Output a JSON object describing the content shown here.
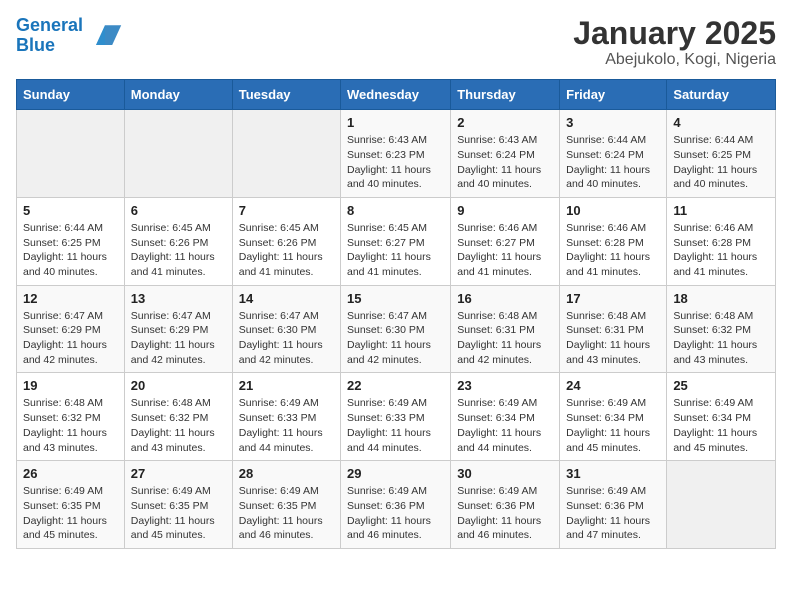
{
  "header": {
    "logo_line1": "General",
    "logo_line2": "Blue",
    "title": "January 2025",
    "subtitle": "Abejukolo, Kogi, Nigeria"
  },
  "weekdays": [
    "Sunday",
    "Monday",
    "Tuesday",
    "Wednesday",
    "Thursday",
    "Friday",
    "Saturday"
  ],
  "weeks": [
    [
      {
        "day": "",
        "sunrise": "",
        "sunset": "",
        "daylight": ""
      },
      {
        "day": "",
        "sunrise": "",
        "sunset": "",
        "daylight": ""
      },
      {
        "day": "",
        "sunrise": "",
        "sunset": "",
        "daylight": ""
      },
      {
        "day": "1",
        "sunrise": "Sunrise: 6:43 AM",
        "sunset": "Sunset: 6:23 PM",
        "daylight": "Daylight: 11 hours and 40 minutes."
      },
      {
        "day": "2",
        "sunrise": "Sunrise: 6:43 AM",
        "sunset": "Sunset: 6:24 PM",
        "daylight": "Daylight: 11 hours and 40 minutes."
      },
      {
        "day": "3",
        "sunrise": "Sunrise: 6:44 AM",
        "sunset": "Sunset: 6:24 PM",
        "daylight": "Daylight: 11 hours and 40 minutes."
      },
      {
        "day": "4",
        "sunrise": "Sunrise: 6:44 AM",
        "sunset": "Sunset: 6:25 PM",
        "daylight": "Daylight: 11 hours and 40 minutes."
      }
    ],
    [
      {
        "day": "5",
        "sunrise": "Sunrise: 6:44 AM",
        "sunset": "Sunset: 6:25 PM",
        "daylight": "Daylight: 11 hours and 40 minutes."
      },
      {
        "day": "6",
        "sunrise": "Sunrise: 6:45 AM",
        "sunset": "Sunset: 6:26 PM",
        "daylight": "Daylight: 11 hours and 41 minutes."
      },
      {
        "day": "7",
        "sunrise": "Sunrise: 6:45 AM",
        "sunset": "Sunset: 6:26 PM",
        "daylight": "Daylight: 11 hours and 41 minutes."
      },
      {
        "day": "8",
        "sunrise": "Sunrise: 6:45 AM",
        "sunset": "Sunset: 6:27 PM",
        "daylight": "Daylight: 11 hours and 41 minutes."
      },
      {
        "day": "9",
        "sunrise": "Sunrise: 6:46 AM",
        "sunset": "Sunset: 6:27 PM",
        "daylight": "Daylight: 11 hours and 41 minutes."
      },
      {
        "day": "10",
        "sunrise": "Sunrise: 6:46 AM",
        "sunset": "Sunset: 6:28 PM",
        "daylight": "Daylight: 11 hours and 41 minutes."
      },
      {
        "day": "11",
        "sunrise": "Sunrise: 6:46 AM",
        "sunset": "Sunset: 6:28 PM",
        "daylight": "Daylight: 11 hours and 41 minutes."
      }
    ],
    [
      {
        "day": "12",
        "sunrise": "Sunrise: 6:47 AM",
        "sunset": "Sunset: 6:29 PM",
        "daylight": "Daylight: 11 hours and 42 minutes."
      },
      {
        "day": "13",
        "sunrise": "Sunrise: 6:47 AM",
        "sunset": "Sunset: 6:29 PM",
        "daylight": "Daylight: 11 hours and 42 minutes."
      },
      {
        "day": "14",
        "sunrise": "Sunrise: 6:47 AM",
        "sunset": "Sunset: 6:30 PM",
        "daylight": "Daylight: 11 hours and 42 minutes."
      },
      {
        "day": "15",
        "sunrise": "Sunrise: 6:47 AM",
        "sunset": "Sunset: 6:30 PM",
        "daylight": "Daylight: 11 hours and 42 minutes."
      },
      {
        "day": "16",
        "sunrise": "Sunrise: 6:48 AM",
        "sunset": "Sunset: 6:31 PM",
        "daylight": "Daylight: 11 hours and 42 minutes."
      },
      {
        "day": "17",
        "sunrise": "Sunrise: 6:48 AM",
        "sunset": "Sunset: 6:31 PM",
        "daylight": "Daylight: 11 hours and 43 minutes."
      },
      {
        "day": "18",
        "sunrise": "Sunrise: 6:48 AM",
        "sunset": "Sunset: 6:32 PM",
        "daylight": "Daylight: 11 hours and 43 minutes."
      }
    ],
    [
      {
        "day": "19",
        "sunrise": "Sunrise: 6:48 AM",
        "sunset": "Sunset: 6:32 PM",
        "daylight": "Daylight: 11 hours and 43 minutes."
      },
      {
        "day": "20",
        "sunrise": "Sunrise: 6:48 AM",
        "sunset": "Sunset: 6:32 PM",
        "daylight": "Daylight: 11 hours and 43 minutes."
      },
      {
        "day": "21",
        "sunrise": "Sunrise: 6:49 AM",
        "sunset": "Sunset: 6:33 PM",
        "daylight": "Daylight: 11 hours and 44 minutes."
      },
      {
        "day": "22",
        "sunrise": "Sunrise: 6:49 AM",
        "sunset": "Sunset: 6:33 PM",
        "daylight": "Daylight: 11 hours and 44 minutes."
      },
      {
        "day": "23",
        "sunrise": "Sunrise: 6:49 AM",
        "sunset": "Sunset: 6:34 PM",
        "daylight": "Daylight: 11 hours and 44 minutes."
      },
      {
        "day": "24",
        "sunrise": "Sunrise: 6:49 AM",
        "sunset": "Sunset: 6:34 PM",
        "daylight": "Daylight: 11 hours and 45 minutes."
      },
      {
        "day": "25",
        "sunrise": "Sunrise: 6:49 AM",
        "sunset": "Sunset: 6:34 PM",
        "daylight": "Daylight: 11 hours and 45 minutes."
      }
    ],
    [
      {
        "day": "26",
        "sunrise": "Sunrise: 6:49 AM",
        "sunset": "Sunset: 6:35 PM",
        "daylight": "Daylight: 11 hours and 45 minutes."
      },
      {
        "day": "27",
        "sunrise": "Sunrise: 6:49 AM",
        "sunset": "Sunset: 6:35 PM",
        "daylight": "Daylight: 11 hours and 45 minutes."
      },
      {
        "day": "28",
        "sunrise": "Sunrise: 6:49 AM",
        "sunset": "Sunset: 6:35 PM",
        "daylight": "Daylight: 11 hours and 46 minutes."
      },
      {
        "day": "29",
        "sunrise": "Sunrise: 6:49 AM",
        "sunset": "Sunset: 6:36 PM",
        "daylight": "Daylight: 11 hours and 46 minutes."
      },
      {
        "day": "30",
        "sunrise": "Sunrise: 6:49 AM",
        "sunset": "Sunset: 6:36 PM",
        "daylight": "Daylight: 11 hours and 46 minutes."
      },
      {
        "day": "31",
        "sunrise": "Sunrise: 6:49 AM",
        "sunset": "Sunset: 6:36 PM",
        "daylight": "Daylight: 11 hours and 47 minutes."
      },
      {
        "day": "",
        "sunrise": "",
        "sunset": "",
        "daylight": ""
      }
    ]
  ]
}
